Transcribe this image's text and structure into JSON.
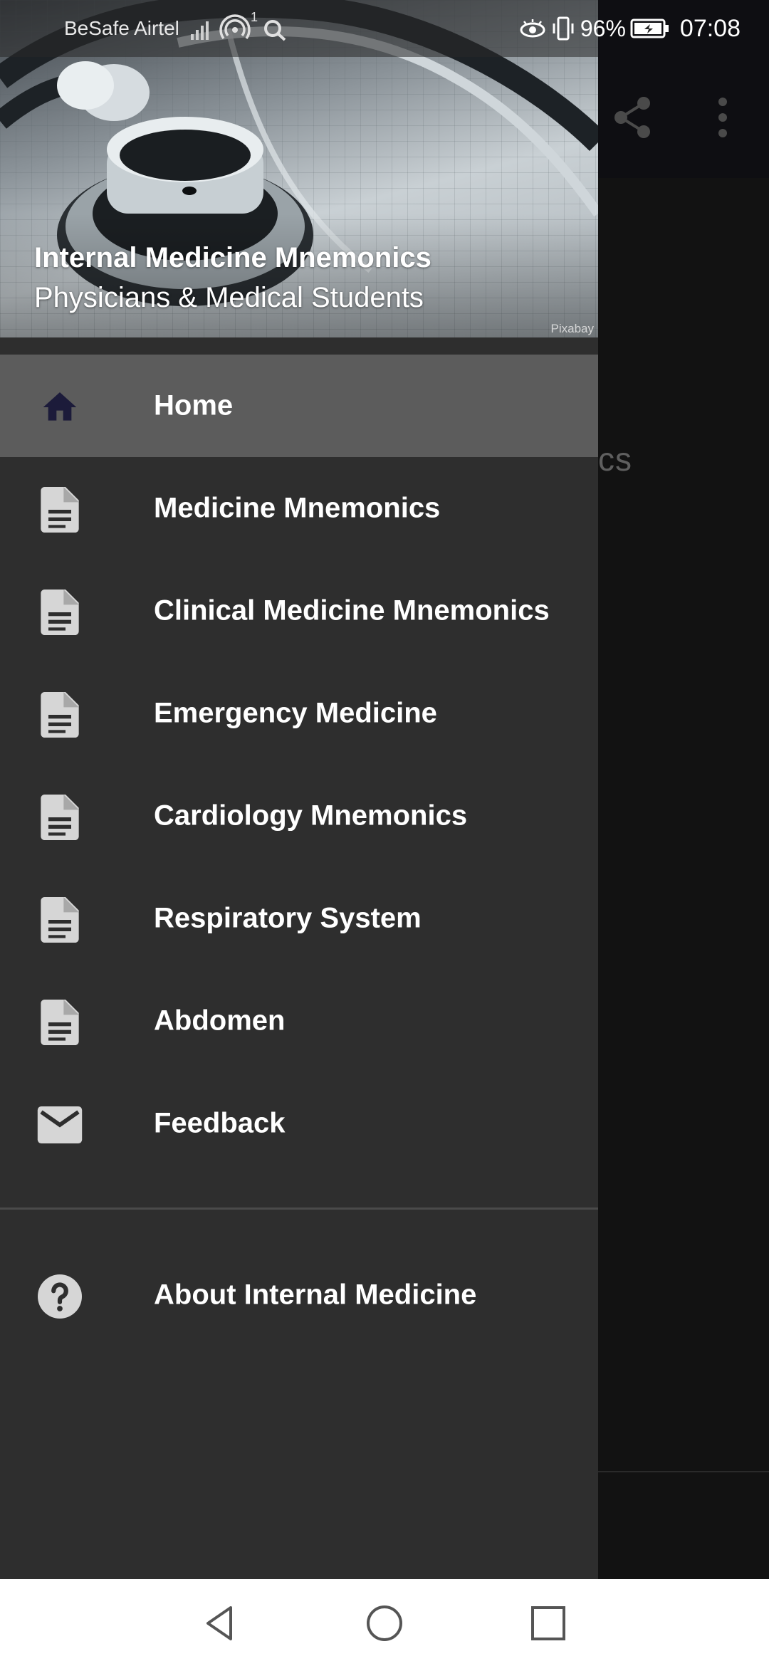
{
  "status_bar": {
    "carrier": "BeSafe Airtel",
    "signal_superscript": "1",
    "battery_percent": "96%",
    "time": "07:08"
  },
  "background_app": {
    "peek_text": "cs",
    "icons": [
      "share-icon",
      "more-vert-icon"
    ]
  },
  "drawer": {
    "header": {
      "title": "Internal Medicine Mnemonics",
      "subtitle": "Physicians & Medical Students",
      "photo_credit": "Pixabay"
    },
    "items": [
      {
        "label": "Home",
        "icon": "home-icon",
        "active": true
      },
      {
        "label": "Medicine Mnemonics",
        "icon": "document-icon"
      },
      {
        "label": "Clinical Medicine Mnemonics",
        "icon": "document-icon"
      },
      {
        "label": "Emergency Medicine",
        "icon": "document-icon"
      },
      {
        "label": "Cardiology Mnemonics",
        "icon": "document-icon"
      },
      {
        "label": "Respiratory System",
        "icon": "document-icon"
      },
      {
        "label": "Abdomen",
        "icon": "document-icon"
      },
      {
        "label": "Feedback",
        "icon": "mail-icon"
      }
    ],
    "secondary_items": [
      {
        "label": "About Internal Medicine",
        "icon": "help-circle-icon"
      }
    ]
  },
  "colors": {
    "drawer_background": "#2e2e2e",
    "active_item_background": "#5c5c5c",
    "home_icon": "#1c1b3a",
    "menu_icon": "#d6d6d6",
    "text": "#ffffff",
    "nav_bar": "#ffffff"
  },
  "nav_bar": {
    "buttons": [
      "back-icon",
      "home-circle-icon",
      "recents-icon"
    ]
  }
}
